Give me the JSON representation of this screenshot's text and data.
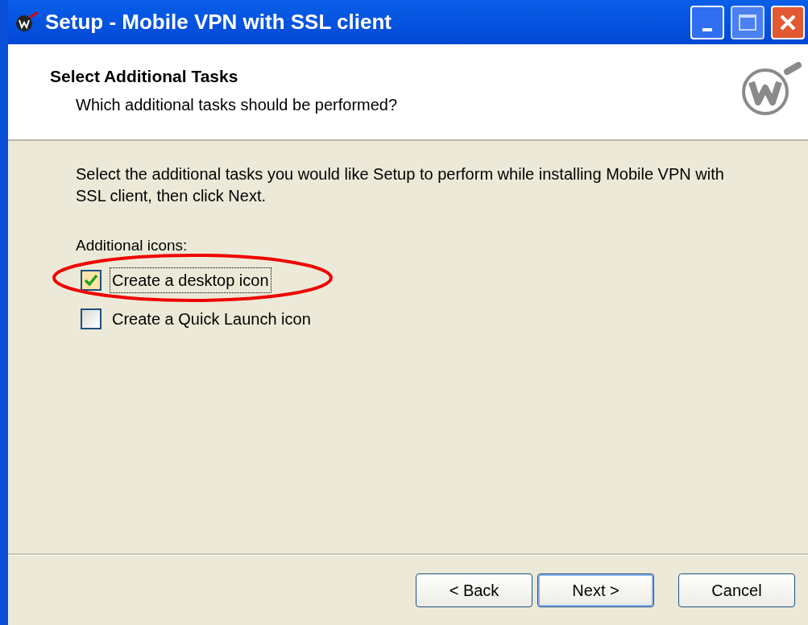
{
  "window": {
    "title": "Setup - Mobile VPN with SSL client"
  },
  "header": {
    "title": "Select Additional Tasks",
    "subtitle": "Which additional tasks should be performed?"
  },
  "intro": "Select the additional tasks you would like Setup to perform while installing Mobile VPN with SSL client, then click Next.",
  "group_label": "Additional icons:",
  "tasks": [
    {
      "label": "Create a desktop icon",
      "checked": true,
      "focused": true,
      "circled": true
    },
    {
      "label": "Create a Quick Launch icon",
      "checked": false,
      "focused": false,
      "circled": false
    }
  ],
  "buttons": [
    {
      "label": "< Back",
      "default": false
    },
    {
      "label": "Next >",
      "default": true
    },
    {
      "label": "Cancel",
      "default": false
    }
  ]
}
